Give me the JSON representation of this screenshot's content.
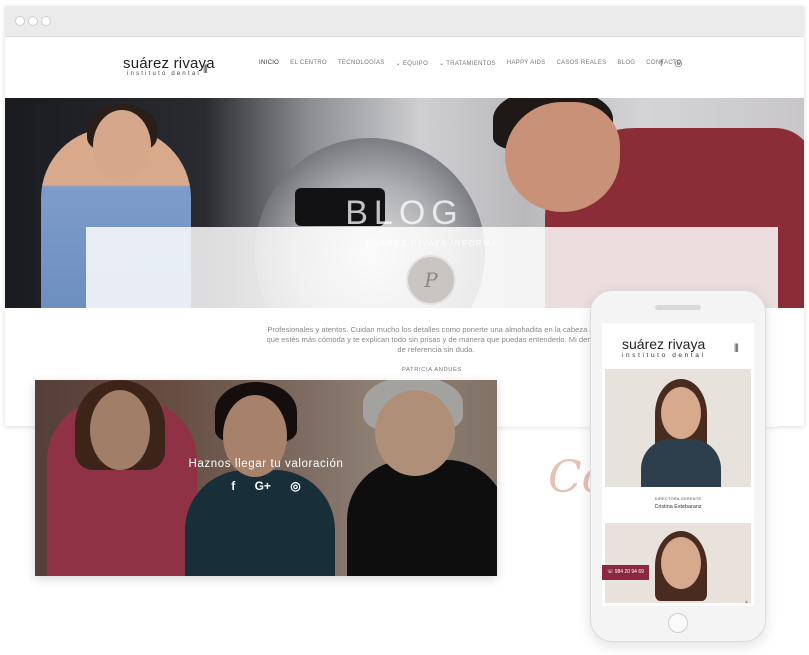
{
  "site": {
    "logo_main": "suárez rivaya",
    "logo_sub": "instituto dental"
  },
  "nav": [
    "INICIO",
    "EL CENTRO",
    "TECNOLOGÍAS",
    "⌄ EQUIPO",
    "⌄ TRATAMIENTOS",
    "HAPPY AIDS",
    "CASOS REALES",
    "BLOG",
    "CONTACTO"
  ],
  "hero": {
    "title": "BLOG",
    "subtitle": "SUÁREZ RIVAYA INFORMA"
  },
  "testimonial": {
    "avatar_initial": "P",
    "quote": "Profesionales y atentos. Cuidan mucho los detalles como ponerte una almohadita en la cabeza para que estés más cómoda y te explican todo sin prisas y de manera que puedas entenderlo. Mi dentista de referencia sin duda.",
    "author": "PATRICIA ANDUES"
  },
  "feedback": {
    "title": "Haznos llegar tu valoración"
  },
  "decor_script": "Co",
  "mobile": {
    "role": "DIRECTORA GERENTE",
    "name": "Cristina Estebaranz",
    "phone": "984 20 94 69"
  },
  "colors": {
    "brand_wine": "#8b2840",
    "script_peach": "#e3b7a6"
  },
  "icons": [
    "facebook-icon",
    "instagram-icon",
    "google-plus-icon",
    "phone-icon"
  ]
}
